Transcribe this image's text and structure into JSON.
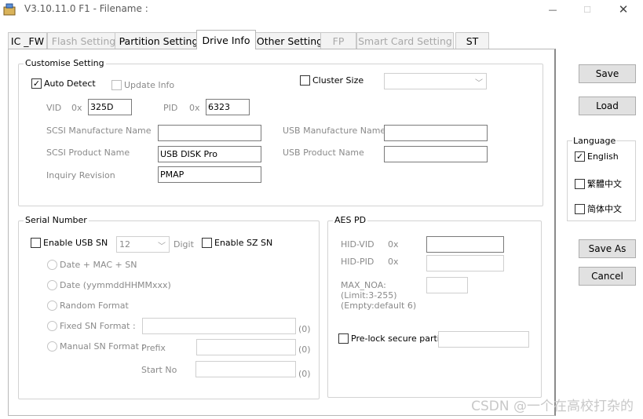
{
  "window": {
    "title": "V3.10.11.0 F1 - Filename :",
    "minimize_glyph": "—",
    "maximize_glyph": "☐",
    "close_glyph": "✕"
  },
  "tabs": [
    {
      "label": "IC _FW",
      "enabled": true
    },
    {
      "label": "Flash Setting",
      "enabled": false
    },
    {
      "label": "Partition Setting",
      "enabled": true
    },
    {
      "label": "Drive Info",
      "enabled": true,
      "active": true
    },
    {
      "label": "Other Setting",
      "enabled": true
    },
    {
      "label": "FP",
      "enabled": false
    },
    {
      "label": "Smart Card Setting",
      "enabled": false
    },
    {
      "label": "ST",
      "enabled": true
    }
  ],
  "customise": {
    "title": "Customise Setting",
    "auto_detect": {
      "label": "Auto Detect",
      "checked": true
    },
    "update_info": {
      "label": "Update Info",
      "checked": false
    },
    "cluster_size": {
      "label": "Cluster Size",
      "checked": false,
      "value": ""
    },
    "vid_label": "VID",
    "vid_prefix": "0x",
    "vid_value": "325D",
    "pid_label": "PID",
    "pid_prefix": "0x",
    "pid_value": "6323",
    "scsi_manufacture_label": "SCSI Manufacture Name",
    "scsi_manufacture_value": "",
    "scsi_product_label": "SCSI Product Name",
    "scsi_product_value": "USB DISK Pro",
    "inquiry_label": "Inquiry Revision",
    "inquiry_value": "PMAP",
    "usb_manufacture_label": "USB Manufacture Name",
    "usb_manufacture_value": "",
    "usb_product_label": "USB Product Name",
    "usb_product_value": ""
  },
  "serial": {
    "title": "Serial Number",
    "enable_usb_sn": {
      "label": "Enable USB SN",
      "checked": false
    },
    "digit_value": "12",
    "digit_label": "Digit",
    "enable_sz_sn": {
      "label": "Enable SZ SN",
      "checked": false
    },
    "radio_date_mac": "Date + MAC + SN",
    "radio_date": "Date (yymmddHHMMxxx)",
    "radio_random": "Random Format",
    "radio_fixed": "Fixed SN Format :",
    "radio_manual": "Manual SN Format :",
    "prefix_label": "Prefix",
    "start_no_label": "Start No",
    "count_fixed": "(0)",
    "count_prefix": "(0)",
    "count_start": "(0)"
  },
  "aes": {
    "title": "AES PD",
    "hid_vid_label": "HID-VID",
    "hid_vid_prefix": "0x",
    "hid_pid_label": "HID-PID",
    "hid_pid_prefix": "0x",
    "max_noa_line1": "MAX_NOA:",
    "max_noa_line2": "(Limit:3-255)",
    "max_noa_line3": "(Empty:default 6)",
    "prelock": {
      "label": "Pre-lock secure partitic",
      "checked": false
    }
  },
  "side": {
    "save": "Save",
    "load": "Load",
    "language_title": "Language",
    "lang_english": {
      "label": "English",
      "checked": true
    },
    "lang_trad": {
      "label": "繁體中文",
      "checked": false
    },
    "lang_simp": {
      "label": "简体中文",
      "checked": false
    },
    "save_as": "Save As",
    "cancel": "Cancel"
  },
  "watermark": "CSDN @一个在高校打杂的"
}
